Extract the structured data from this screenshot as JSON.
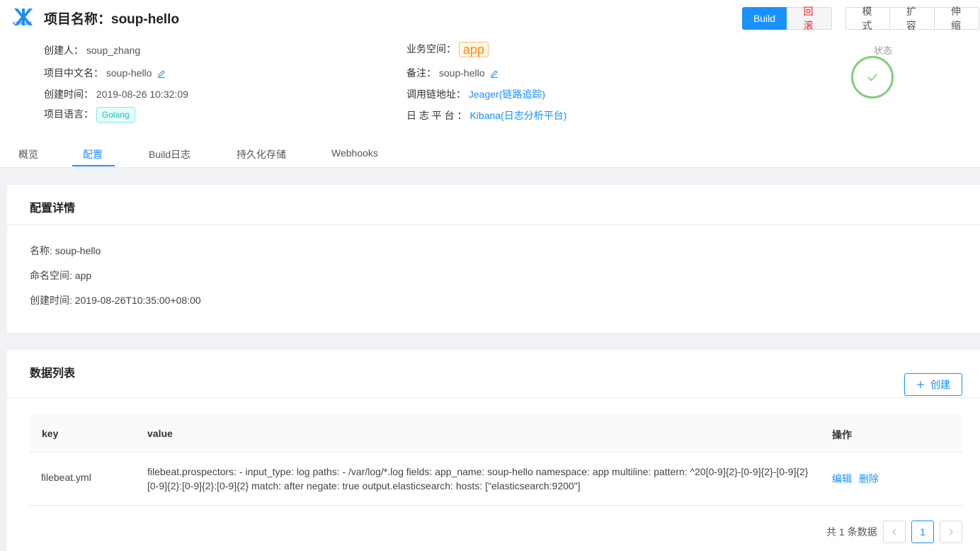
{
  "header": {
    "logo_text": "KEPLER",
    "title": "项目名称：soup-hello",
    "actions": {
      "build": "Build",
      "rollback": "回 滚",
      "mode": "模 式",
      "scale_out": "扩 容",
      "scale": "伸 缩"
    }
  },
  "info": {
    "creator_label": "创建人：",
    "creator_value": "soup_zhang",
    "cn_name_label": "项目中文名：",
    "cn_name_value": "soup-hello",
    "created_label": "创建时间：",
    "created_value": "2019-08-26 10:32:09",
    "lang_label": "项目语言：",
    "lang_value": "Golang",
    "space_label": "业务空间：",
    "space_value": "app",
    "remark_label": "备注：",
    "remark_value": "soup-hello",
    "trace_label": "调用链地址：",
    "trace_value": "Jeager(链路追踪)",
    "log_label": "日 志 平 台 ：",
    "log_value": "Kibana(日志分析平台)",
    "status_label": "状态"
  },
  "tabs": [
    "概览",
    "配置",
    "Build日志",
    "持久化存储",
    "Webhooks"
  ],
  "config_card": {
    "title": "配置详情",
    "name": "名称: soup-hello",
    "namespace": "命名空间: app",
    "created": "创建时间: 2019-08-26T10:35:00+08:00"
  },
  "data_card": {
    "title": "数据列表",
    "create_label": "创建",
    "columns": {
      "key": "key",
      "value": "value",
      "ops": "操作"
    },
    "rows": [
      {
        "key": "filebeat.yml",
        "value": "filebeat.prospectors: - input_type: log paths: - /var/log/*.log fields: app_name: soup-hello namespace: app multiline: pattern: ^20[0-9]{2}-[0-9]{2}-[0-9]{2} [0-9]{2}:[0-9]{2}:[0-9]{2} match: after negate: true output.elasticsearch: hosts: [\"elasticsearch:9200\"]",
        "edit": "编辑",
        "delete": "删除"
      }
    ],
    "pager": {
      "total": "共 1 条数据",
      "current": "1"
    }
  },
  "colors": {
    "primary": "#1890ff",
    "danger": "#f5222d",
    "success": "#7ed07a",
    "warning": "#fa8c16"
  }
}
